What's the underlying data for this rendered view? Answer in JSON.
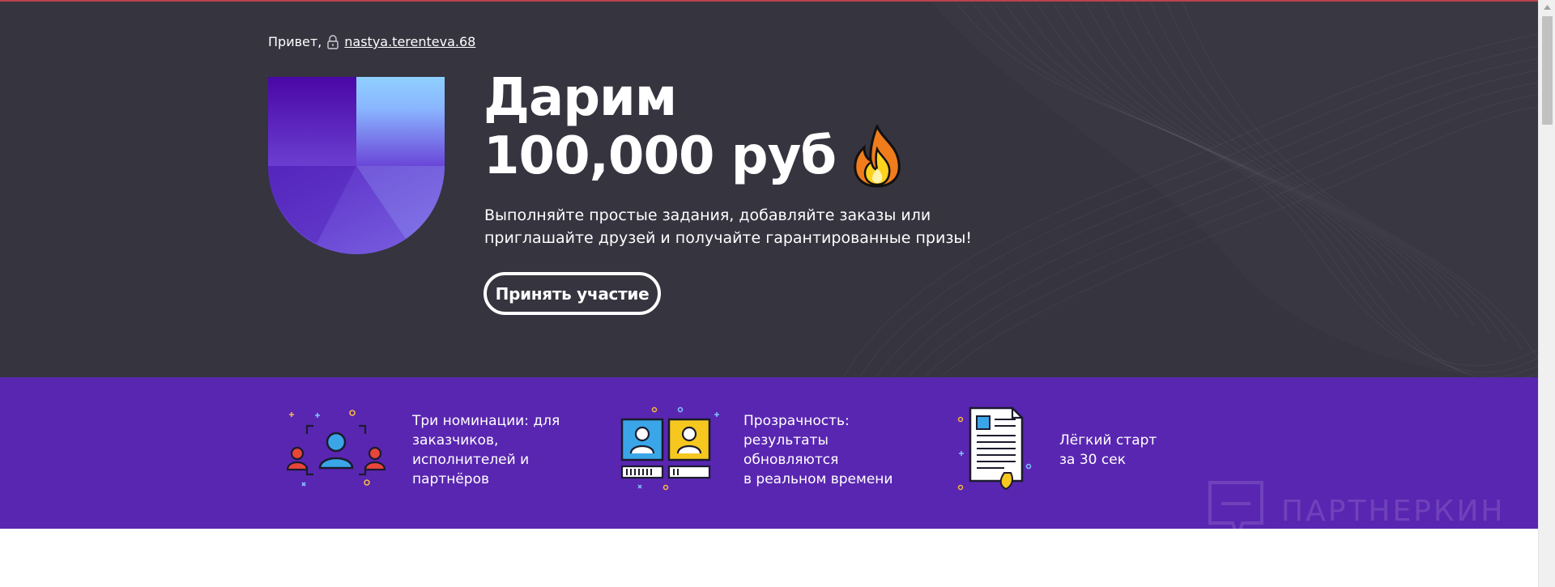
{
  "hero": {
    "greeting": "Привет,",
    "username": "nastya.terenteva.68",
    "headline_line1": "Дарим",
    "headline_line2": "100,000 руб",
    "subtitle_line1": "Выполняйте простые задания, добавляйте заказы или",
    "subtitle_line2": "приглашайте друзей и получайте гарантированные призы!",
    "cta_label": "Принять участие"
  },
  "features": [
    {
      "icon": "users-nomination-icon",
      "text_lines": [
        "Три номинации: для",
        "заказчиков,",
        "исполнителей и",
        "партнёров"
      ]
    },
    {
      "icon": "profiles-transparency-icon",
      "text_lines": [
        "Прозрачность:",
        "результаты обновляются",
        "в реальном времени"
      ]
    },
    {
      "icon": "document-icon",
      "text_lines": [
        "Лёгкий старт",
        "за 30 сек"
      ]
    }
  ],
  "watermark": {
    "text": "ПАРТНЕРКИН"
  },
  "colors": {
    "hero_bg": "#35343f",
    "features_bg": "#5926b1",
    "text": "#ffffff"
  }
}
